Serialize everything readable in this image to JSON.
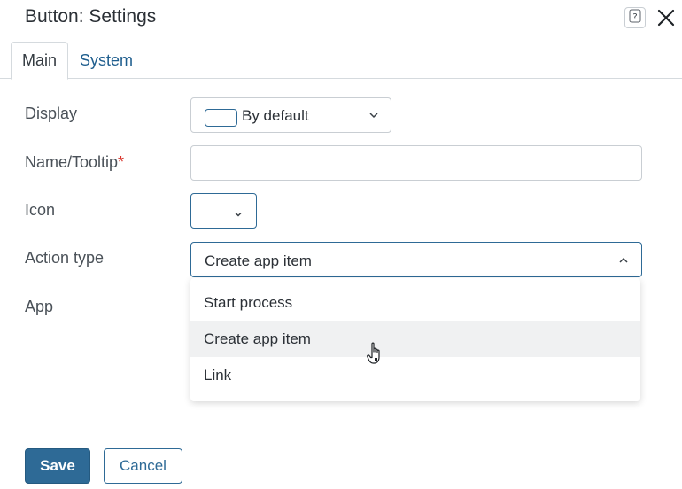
{
  "dialog": {
    "title": "Button: Settings",
    "help_icon": "question-mark-icon",
    "close_icon": "close-icon"
  },
  "tabs": [
    {
      "label": "Main",
      "active": true
    },
    {
      "label": "System",
      "active": false
    }
  ],
  "form": {
    "display": {
      "label": "Display",
      "value": "By default"
    },
    "name_tooltip": {
      "label": "Name/Tooltip",
      "required_mark": "*",
      "value": "",
      "placeholder": ""
    },
    "icon": {
      "label": "Icon",
      "value": ""
    },
    "action_type": {
      "label": "Action type",
      "value": "Create app item",
      "options": [
        "Start process",
        "Create app item",
        "Link"
      ],
      "hovered_option": "Create app item"
    },
    "app": {
      "label": "App"
    }
  },
  "footer": {
    "save_label": "Save",
    "cancel_label": "Cancel"
  },
  "colors": {
    "accent": "#2e6a96",
    "required": "#d9342b",
    "tab_inactive": "#1f5e8e",
    "hover_bg": "#f0f1f2"
  }
}
